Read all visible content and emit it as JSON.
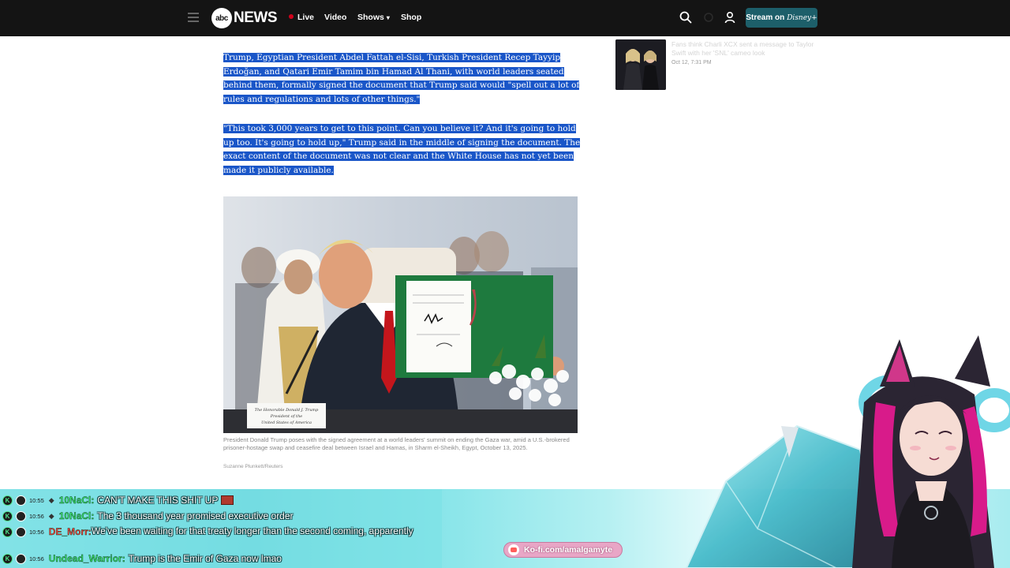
{
  "nav": {
    "logo_mark": "abc",
    "logo_text": "NEWS",
    "items": [
      {
        "label": "Live"
      },
      {
        "label": "Video"
      },
      {
        "label": "Shows"
      },
      {
        "label": "Shop"
      }
    ],
    "stream_label": "Stream on",
    "stream_brand": "Disney+"
  },
  "article": {
    "para1": "Trump, Egyptian President Abdel Fattah el-Sisi, Turkish President Recep Tayyip Erdoğan, and Qatari Emir Tamim bin Hamad Al Thani, with world leaders seated behind them, formally signed the document that Trump said would \"spell out a lot of rules and regulations and lots of other things.\"",
    "para2": "\"This took 3,000 years to get to this point. Can you believe it? And it's going to hold up too. It's going to hold up,\" Trump said in the middle of signing the document. The exact content of the document was not clear and the White House has not yet been made it publicly available.",
    "caption": "President Donald Trump poses with the signed agreement at a world leaders' summit on ending the Gaza war, amid a U.S.-brokered prisoner-hostage swap and ceasefire deal between Israel and Hamas, in Sharm el-Sheikh, Egypt, October 13, 2025.",
    "credit": "Suzanne Plunkett/Reuters",
    "placard": "The Honorable Donald J. Trump President of the United States of America"
  },
  "sidebar": {
    "title": "Fans think Charli XCX sent a message to Taylor Swift with her 'SNL' cameo look",
    "date": "Oct 12, 7:31 PM"
  },
  "chat": [
    {
      "time": "10:55",
      "user": "10NaCl:",
      "user_color": "#36e06a",
      "message": "CAN'T MAKE THIS SHIT UP"
    },
    {
      "time": "10:56",
      "user": "10NaCl:",
      "user_color": "#36e06a",
      "message": "The 3 thousand year promised executive order"
    },
    {
      "time": "10:56",
      "user": "DE_Morr:",
      "user_color": "#ff3a3a",
      "message": "We've been waiting for that treaty longer than the second coming, apparently"
    },
    {
      "time": "10:56",
      "user": "Undead_Warrior:",
      "user_color": "#36e06a",
      "message": "Trump is the Emir of Gaza now lmao"
    }
  ],
  "kofi": {
    "label": "Ko-fi.com/amalgamyte"
  },
  "colors": {
    "selection": "#1a56c8",
    "nav_bg": "#141414",
    "stream_btn": "#1d5f6a",
    "chat_teal": "#6fd6dd"
  }
}
